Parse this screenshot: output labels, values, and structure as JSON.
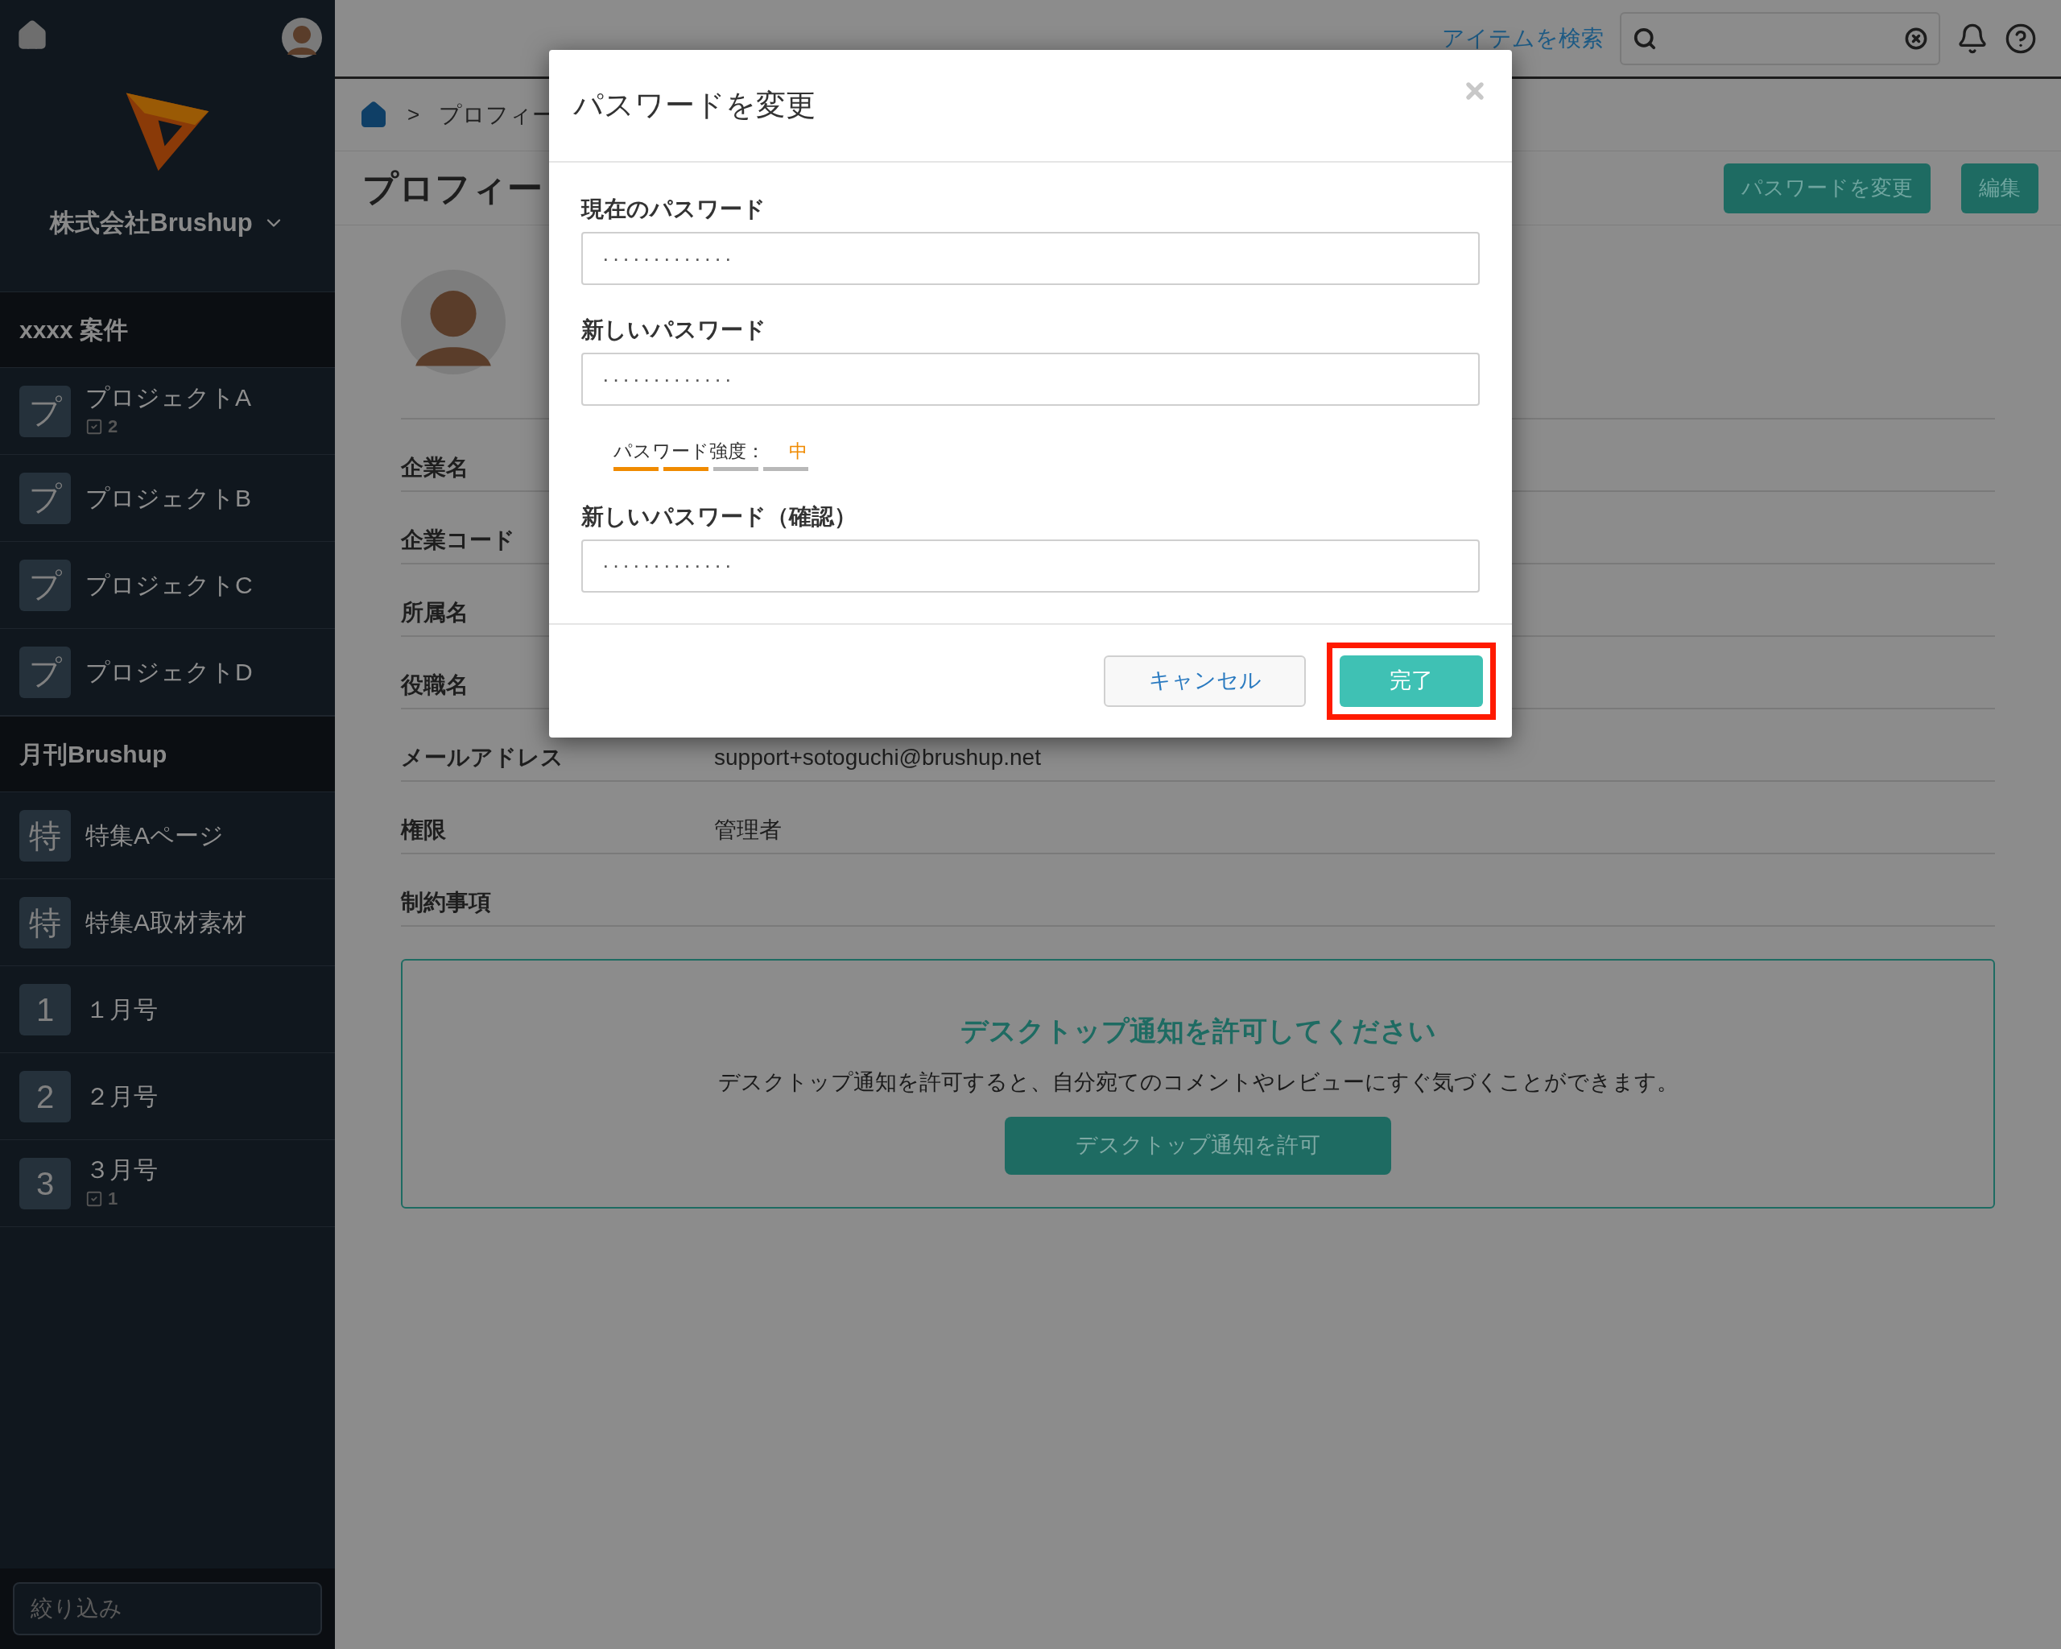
{
  "topbar": {
    "search_link": "アイテムを検索"
  },
  "sidebar": {
    "company": "株式会社Brushup",
    "groups": [
      {
        "title": "xxxx 案件",
        "items": [
          {
            "icon_text": "プ",
            "label": "プロジェクトA",
            "count": "2"
          },
          {
            "icon_text": "プ",
            "label": "プロジェクトB"
          },
          {
            "icon_text": "プ",
            "label": "プロジェクトC"
          },
          {
            "icon_text": "プ",
            "label": "プロジェクトD"
          }
        ]
      },
      {
        "title": "月刊Brushup",
        "items": [
          {
            "icon_text": "特",
            "label": "特集Aページ"
          },
          {
            "icon_text": "特",
            "label": "特集A取材素材"
          },
          {
            "icon_text": "1",
            "label": "１月号"
          },
          {
            "icon_text": "2",
            "label": "２月号"
          },
          {
            "icon_text": "3",
            "label": "３月号",
            "count": "1"
          }
        ]
      }
    ],
    "filter": {
      "placeholder": "絞り込み"
    }
  },
  "breadcrumb": [
    {
      "separator": ">",
      "label": "プロフィー"
    }
  ],
  "page": {
    "title": "プロフィー",
    "buttons": [
      "パスワードを変更",
      "編集"
    ]
  },
  "profile": {
    "fields": [
      {
        "label": "企業名"
      },
      {
        "label": "企業コード"
      },
      {
        "label": "所属名"
      },
      {
        "label": "役職名"
      },
      {
        "label": "メールアドレス",
        "value": "support+sotoguchi@brushup.net"
      },
      {
        "label": "権限",
        "value": "管理者"
      },
      {
        "label": "制約事項"
      }
    ]
  },
  "notification": {
    "title": "デスクトップ通知を許可してください",
    "text": "デスクトップ通知を許可すると、自分宛てのコメントやレビューにすぐ気づくことができます。",
    "button": "デスクトップ通知を許可"
  },
  "dialog": {
    "title": "パスワードを変更",
    "fields": [
      {
        "label": "現在のパスワード",
        "value": "·············"
      },
      {
        "label": "新しいパスワード",
        "value": "·············"
      },
      {
        "label": "新しいパスワード（確認）",
        "value": "·············"
      }
    ],
    "strength": {
      "label": "パスワード強度：",
      "value": "中",
      "level": 0.5
    },
    "buttons": [
      {
        "label": "キャンセル",
        "kind": "secondary",
        "highlighted": false
      },
      {
        "label": "完了",
        "kind": "primary",
        "highlighted": true
      }
    ]
  }
}
